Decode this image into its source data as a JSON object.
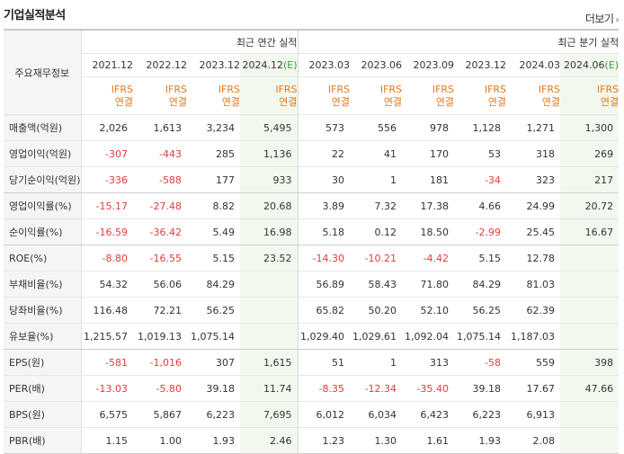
{
  "page": {
    "title": "기업실적분석",
    "more_label": "더보기",
    "left_header": "주요재무정보"
  },
  "groups": {
    "annual": "최근 연간 실적",
    "quarter": "최근 분기 실적"
  },
  "periods": [
    {
      "label": "2021.12",
      "est": ""
    },
    {
      "label": "2022.12",
      "est": ""
    },
    {
      "label": "2023.12",
      "est": ""
    },
    {
      "label": "2024.12",
      "est": "(E)"
    },
    {
      "label": "2023.03",
      "est": ""
    },
    {
      "label": "2023.06",
      "est": ""
    },
    {
      "label": "2023.09",
      "est": ""
    },
    {
      "label": "2023.12",
      "est": ""
    },
    {
      "label": "2024.03",
      "est": ""
    },
    {
      "label": "2024.06",
      "est": "(E)"
    }
  ],
  "ifrs": {
    "line1": "IFRS",
    "line2": "연결"
  },
  "rows": [
    {
      "label": "매출액(억원)",
      "values": [
        "2,026",
        "1,613",
        "3,234",
        "5,495",
        "573",
        "556",
        "978",
        "1,128",
        "1,271",
        "1,300"
      ]
    },
    {
      "label": "영업이익(억원)",
      "values": [
        "-307",
        "-443",
        "285",
        "1,136",
        "22",
        "41",
        "170",
        "53",
        "318",
        "269"
      ]
    },
    {
      "label": "당기순이익(억원)",
      "values": [
        "-336",
        "-588",
        "177",
        "933",
        "30",
        "1",
        "181",
        "-34",
        "323",
        "217"
      ]
    },
    {
      "label": "영업이익률(%)",
      "values": [
        "-15.17",
        "-27.48",
        "8.82",
        "20.68",
        "3.89",
        "7.32",
        "17.38",
        "4.66",
        "24.99",
        "20.72"
      ]
    },
    {
      "label": "순이익률(%)",
      "values": [
        "-16.59",
        "-36.42",
        "5.49",
        "16.98",
        "5.18",
        "0.12",
        "18.50",
        "-2.99",
        "25.45",
        "16.67"
      ]
    },
    {
      "label": "ROE(%)",
      "values": [
        "-8.80",
        "-16.55",
        "5.15",
        "23.52",
        "-14.30",
        "-10.21",
        "-4.42",
        "5.15",
        "12.78",
        ""
      ]
    },
    {
      "label": "부채비율(%)",
      "values": [
        "54.32",
        "56.06",
        "84.29",
        "",
        "56.89",
        "58.43",
        "71.80",
        "84.29",
        "81.03",
        ""
      ]
    },
    {
      "label": "당좌비율(%)",
      "values": [
        "116.48",
        "72.21",
        "56.25",
        "",
        "65.82",
        "50.20",
        "52.10",
        "56.25",
        "62.39",
        ""
      ]
    },
    {
      "label": "유보율(%)",
      "values": [
        "1,215.57",
        "1,019.13",
        "1,075.14",
        "",
        "1,029.40",
        "1,029.61",
        "1,092.04",
        "1,075.14",
        "1,187.03",
        ""
      ]
    },
    {
      "label": "EPS(원)",
      "values": [
        "-581",
        "-1,016",
        "307",
        "1,615",
        "51",
        "1",
        "313",
        "-58",
        "559",
        "398"
      ]
    },
    {
      "label": "PER(배)",
      "values": [
        "-13.03",
        "-5.80",
        "39.18",
        "11.74",
        "-8.35",
        "-12.34",
        "-35.40",
        "39.18",
        "17.67",
        "47.66"
      ]
    },
    {
      "label": "BPS(원)",
      "values": [
        "6,575",
        "5,867",
        "6,223",
        "7,695",
        "6,012",
        "6,034",
        "6,423",
        "6,223",
        "6,913",
        ""
      ]
    },
    {
      "label": "PBR(배)",
      "values": [
        "1.15",
        "1.00",
        "1.93",
        "2.46",
        "1.23",
        "1.30",
        "1.61",
        "1.93",
        "2.08",
        ""
      ]
    }
  ],
  "colors": {
    "negative": "#e33b3b",
    "ifrs": "#e0791f",
    "estimate_bg": "#f2f8ee",
    "estimate_label": "#3a9a3a"
  }
}
